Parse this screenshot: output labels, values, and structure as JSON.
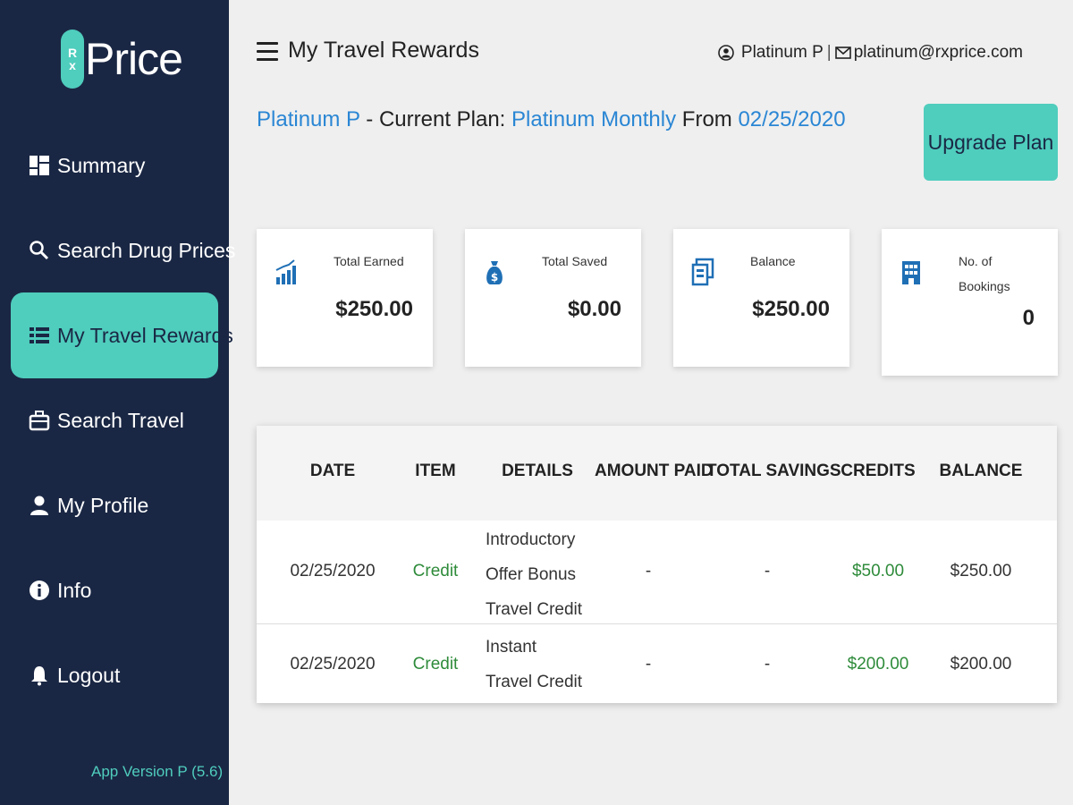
{
  "sidebar": {
    "logo": {
      "badge_top": "R",
      "badge_bottom": "x",
      "text": "Price"
    },
    "items": [
      {
        "label": "Summary",
        "icon": "dashboard-icon"
      },
      {
        "label": "Search Drug Prices",
        "icon": "search-icon"
      },
      {
        "label": "My Travel Rewards",
        "icon": "list-icon",
        "active": true
      },
      {
        "label": "Search Travel",
        "icon": "suitcase-icon"
      },
      {
        "label": "My Profile",
        "icon": "user-icon"
      },
      {
        "label": "Info",
        "icon": "info-icon"
      },
      {
        "label": "Logout",
        "icon": "bell-icon"
      }
    ],
    "version": "App Version P (5.6)"
  },
  "header": {
    "title": "My Travel Rewards",
    "user_name": "Platinum P",
    "separator": "|",
    "email": "platinum@rxprice.com"
  },
  "plan": {
    "name": "Platinum P",
    "prefix": " - Current Plan: ",
    "plan_name": "Platinum",
    "period": "Monthly",
    "from_label": " From ",
    "from_date": "02/25/2020",
    "upgrade_label": "Upgrade Plan"
  },
  "stats": [
    {
      "label": "Total Earned",
      "value": "$250.00",
      "icon": "chart-bars-icon"
    },
    {
      "label": "Total Saved",
      "value": "$0.00",
      "icon": "money-bag-icon"
    },
    {
      "label": "Balance",
      "value": "$250.00",
      "icon": "ticket-icon"
    },
    {
      "label_line1": "No. of",
      "label_line2": "Bookings",
      "value": "0",
      "icon": "building-icon"
    }
  ],
  "table": {
    "headers": [
      "DATE",
      "ITEM",
      "DETAILS",
      "AMOUNT PAID",
      "TOTAL SAVINGS",
      "CREDITS",
      "BALANCE"
    ],
    "rows": [
      {
        "date": "02/25/2020",
        "item": "Credit",
        "details": "Introductory Offer Bonus Travel Credit",
        "amount_paid": "-",
        "total_savings": "-",
        "credits": "$50.00",
        "balance": "$250.00"
      },
      {
        "date": "02/25/2020",
        "item": "Credit",
        "details": "Instant Travel Credit",
        "amount_paid": "-",
        "total_savings": "-",
        "credits": "$200.00",
        "balance": "$200.00"
      }
    ]
  },
  "colors": {
    "sidebar": "#1a2744",
    "accent": "#4fcdbd",
    "link": "#2a86d4",
    "credit": "#2e8b3a"
  }
}
